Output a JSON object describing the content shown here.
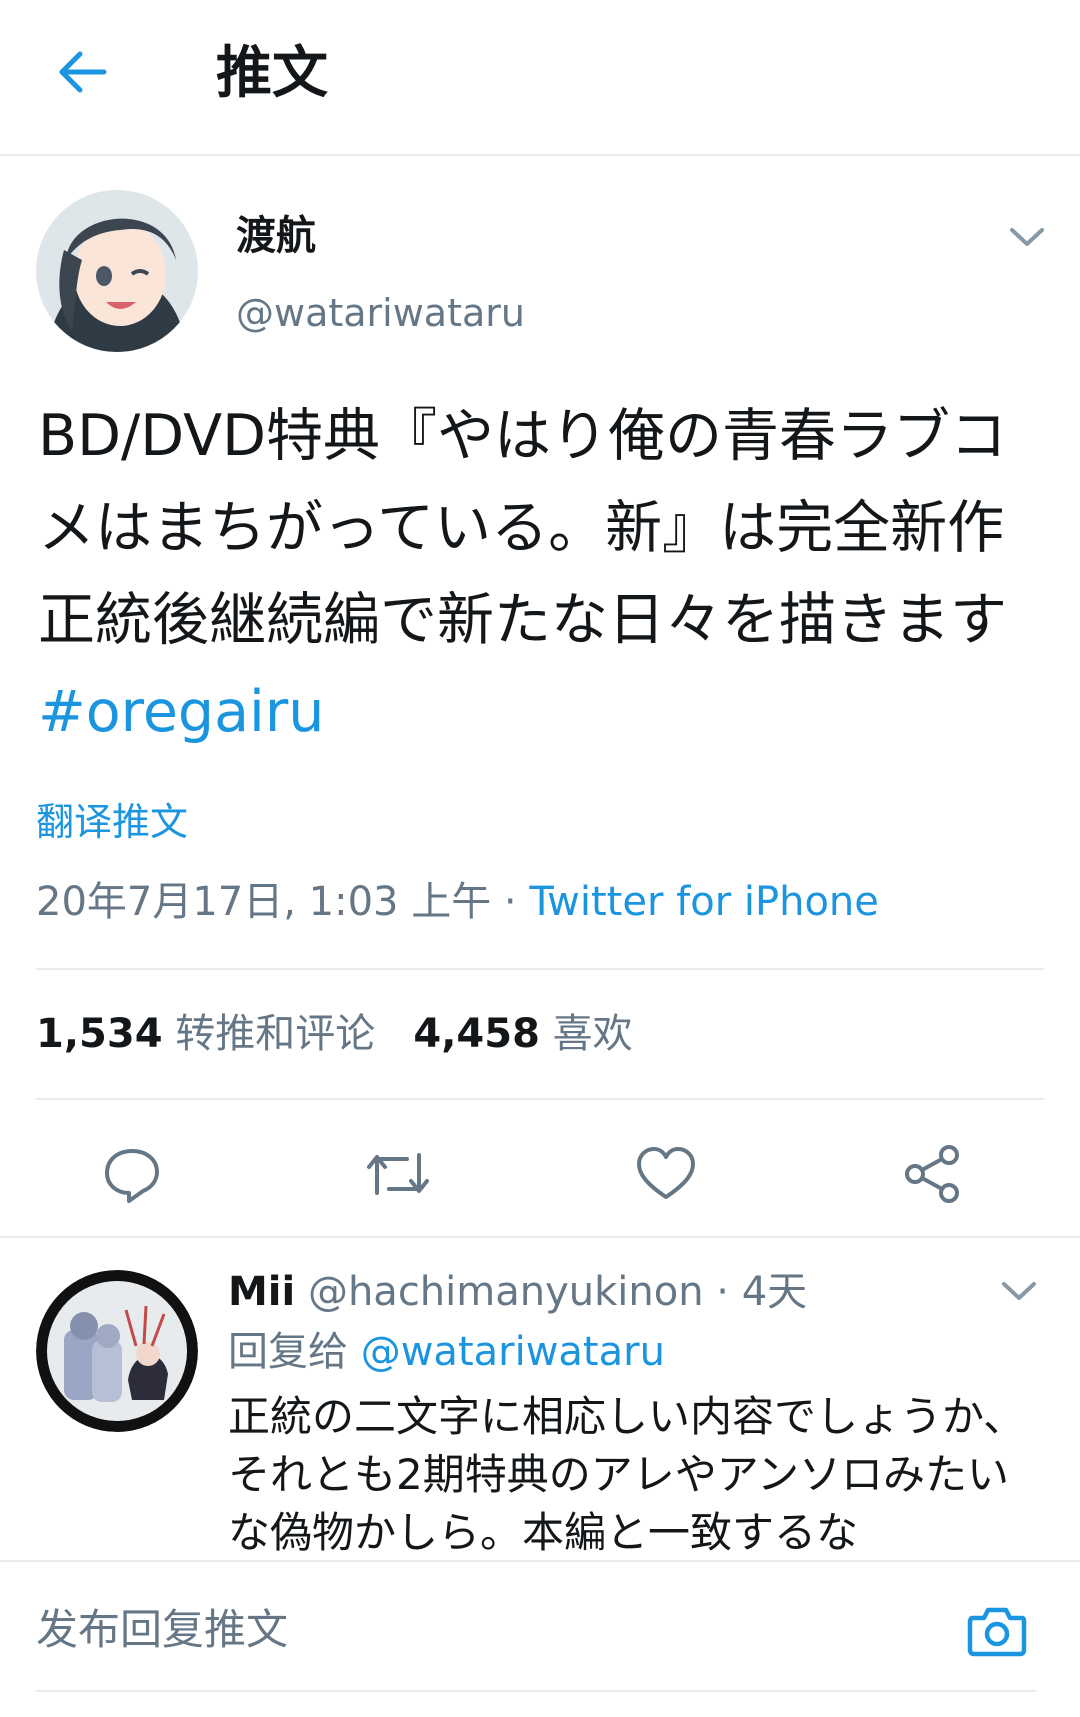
{
  "header": {
    "title": "推文",
    "back_icon": "arrow-left-icon"
  },
  "colors": {
    "accent": "#1b95e0",
    "muted": "#657786",
    "divider": "#e6ecf0"
  },
  "tweet": {
    "author_name": "渡航",
    "author_handle": "@watariwataru",
    "text": "BD/DVD特典『やはり俺の青春ラブコメはまちがっている。新』は完全新作正統後継続編で新たな日々を描きます ",
    "hashtag": "#oregairu",
    "translate_label": "翻译推文",
    "timestamp": "20年7月17日, 1:03 上午 · ",
    "source": "Twitter for iPhone",
    "retweet_count": "1,534",
    "retweet_label": "转推和评论",
    "like_count": "4,458",
    "like_label": "喜欢"
  },
  "actions": [
    "reply-icon",
    "retweet-icon",
    "like-icon",
    "share-icon"
  ],
  "reply": {
    "name": "Mii",
    "handle": "@hachimanyukinon · 4天",
    "reply_to_label": "回复给 ",
    "reply_to_handle": "@watariwataru",
    "text": "正統の二文字に相応しい内容でしょうか、それとも2期特典のアレやアンソロみたいな偽物かしら。本編と一致するな"
  },
  "compose": {
    "placeholder": "发布回复推文",
    "camera_icon": "camera-icon"
  }
}
